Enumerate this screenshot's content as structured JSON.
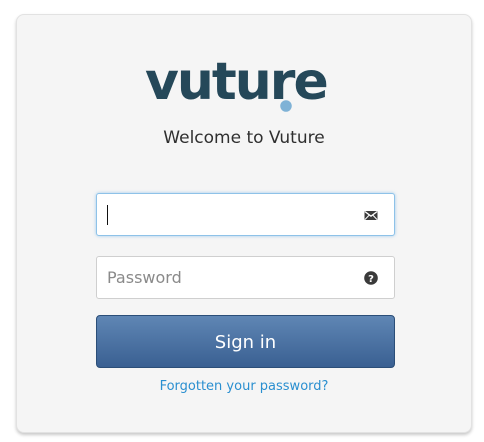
{
  "brand": {
    "logo_text": "vuture",
    "text_color": "#254859",
    "dot_color": "#7fb2d6"
  },
  "welcome_text": "Welcome to Vuture",
  "email_field": {
    "value": "",
    "placeholder": "",
    "icon": "envelope-icon"
  },
  "password_field": {
    "value": "",
    "placeholder": "Password",
    "icon": "question-circle-icon"
  },
  "signin_button": {
    "label": "Sign in",
    "color": "#4a72a3"
  },
  "forgot_link": {
    "label": "Forgotten your password?",
    "color": "#2a8fd0"
  }
}
